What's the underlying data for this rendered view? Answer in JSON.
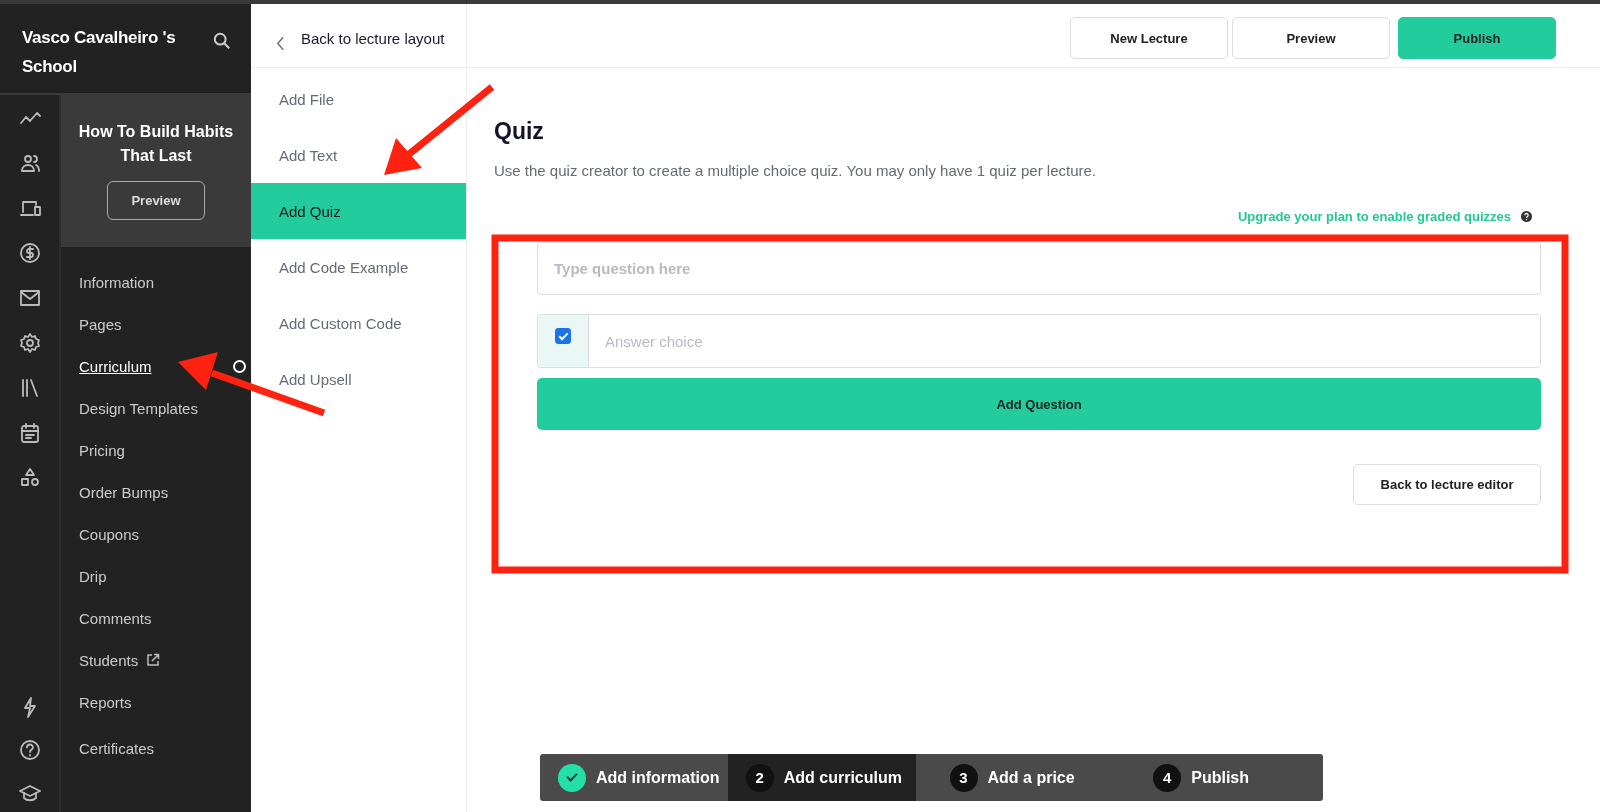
{
  "sidebar": {
    "school_name": "Vasco Cavalheiro 's School",
    "course_title": "How To Build Habits That Last",
    "preview_button": "Preview",
    "items": [
      {
        "label": "Information",
        "selected": false
      },
      {
        "label": "Pages",
        "selected": false
      },
      {
        "label": "Curriculum",
        "selected": true,
        "indicator": true
      },
      {
        "label": "Design Templates",
        "selected": false
      },
      {
        "label": "Pricing",
        "selected": false
      },
      {
        "label": "Order Bumps",
        "selected": false
      },
      {
        "label": "Coupons",
        "selected": false
      },
      {
        "label": "Drip",
        "selected": false
      },
      {
        "label": "Comments",
        "selected": false
      },
      {
        "label": "Students",
        "selected": false,
        "external": true
      },
      {
        "label": "Reports",
        "selected": false
      },
      {
        "label": "Certificates",
        "selected": false
      }
    ]
  },
  "back_link": "Back to lecture layout",
  "lecture_menu": [
    {
      "label": "Add File",
      "selected": false
    },
    {
      "label": "Add Text",
      "selected": false
    },
    {
      "label": "Add Quiz",
      "selected": true
    },
    {
      "label": "Add Code Example",
      "selected": false
    },
    {
      "label": "Add Custom Code",
      "selected": false
    },
    {
      "label": "Add Upsell",
      "selected": false
    }
  ],
  "header_buttons": [
    {
      "label": "New Lecture",
      "kind": "secondary"
    },
    {
      "label": "Preview",
      "kind": "secondary"
    },
    {
      "label": "Publish",
      "kind": "primary"
    }
  ],
  "quiz": {
    "title": "Quiz",
    "description": "Use the quiz creator to create a multiple choice quiz. You may only have 1 quiz per lecture.",
    "upgrade_link": "Upgrade your plan to enable graded quizzes",
    "question": {
      "placeholder": "Type question here"
    },
    "answer": {
      "checked": true,
      "placeholder": "Answer choice"
    },
    "add_button": "Add Question",
    "back_button": "Back to lecture editor"
  },
  "steps": [
    {
      "label": "Add information",
      "completed": true,
      "selected": false
    },
    {
      "number": "2",
      "label": "Add curriculum",
      "completed": false,
      "selected": true
    },
    {
      "number": "3",
      "label": "Add a price",
      "completed": false,
      "selected": false
    },
    {
      "number": "4",
      "label": "Publish",
      "completed": false,
      "selected": false
    }
  ]
}
